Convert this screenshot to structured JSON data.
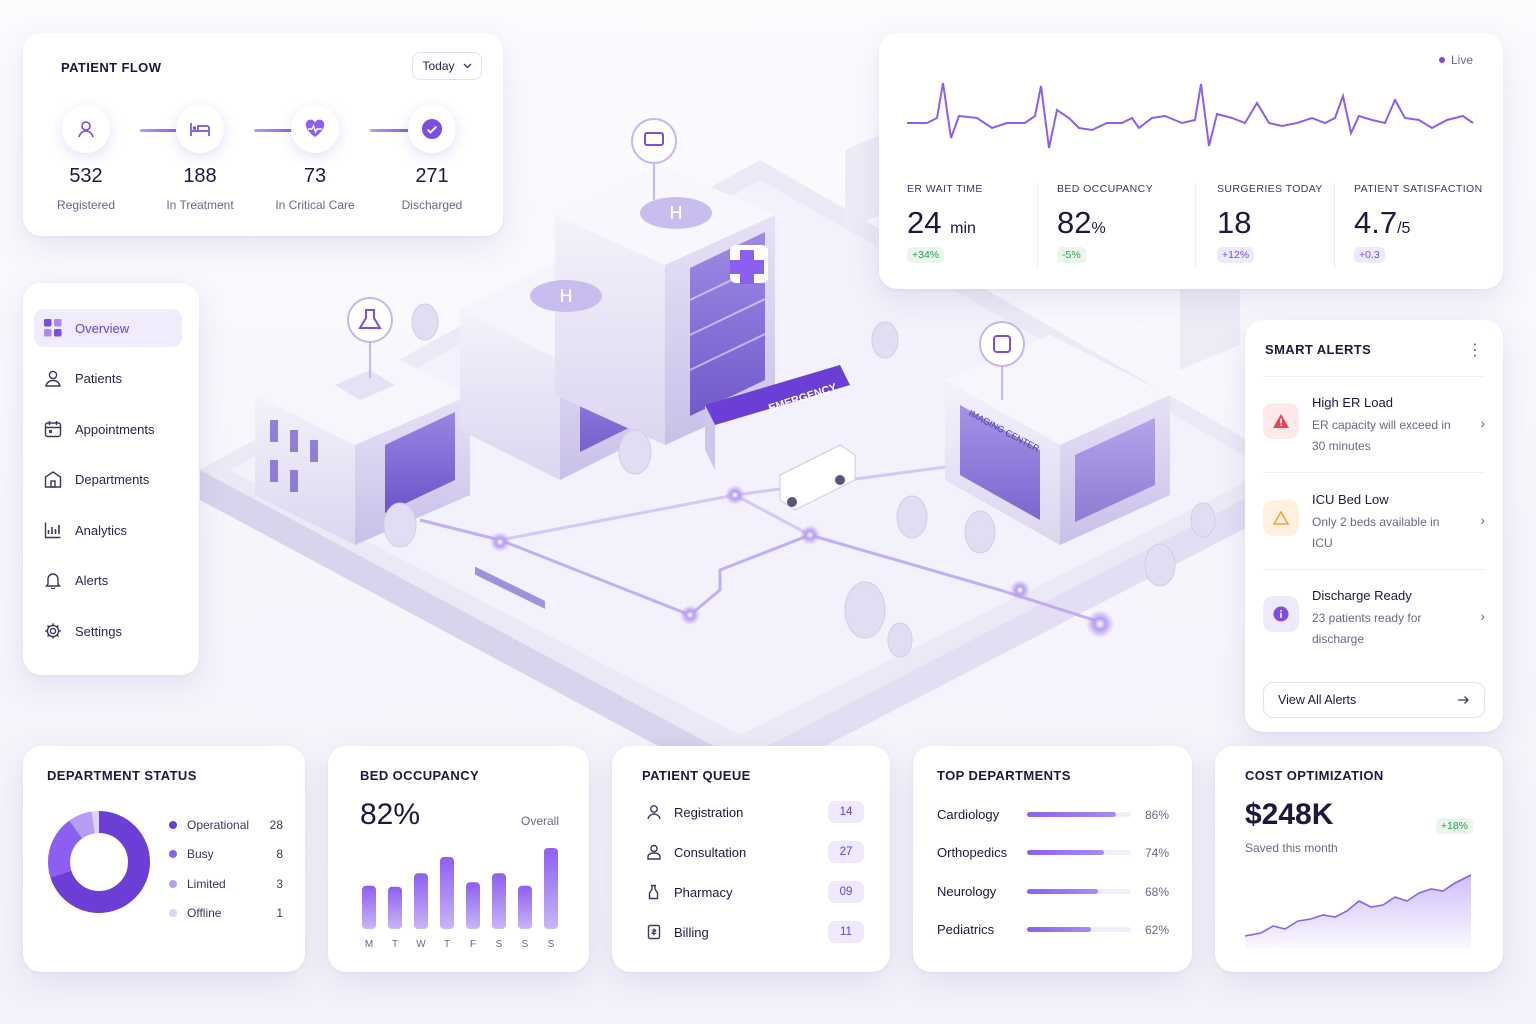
{
  "patient_flow": {
    "title": "PATIENT FLOW",
    "period": "Today",
    "steps": [
      {
        "value": "532",
        "label": "Registered",
        "icon": "user-icon"
      },
      {
        "value": "188",
        "label": "In Treatment",
        "icon": "bed-icon"
      },
      {
        "value": "73",
        "label": "In Critical Care",
        "icon": "heart-pulse-icon"
      },
      {
        "value": "271",
        "label": "Discharged",
        "icon": "check-icon"
      }
    ]
  },
  "vitals": {
    "live_label": "Live",
    "metrics": [
      {
        "label": "ER WAIT TIME",
        "value": "24",
        "unit": "min",
        "delta": "+34%"
      },
      {
        "label": "BED OCCUPANCY",
        "value": "82",
        "unit": "%",
        "delta": "-5%"
      },
      {
        "label": "SURGERIES TODAY",
        "value": "18",
        "unit": "",
        "delta": "+12%"
      },
      {
        "label": "PATIENT SATISFACTION",
        "value": "4.7",
        "unit": "/5",
        "delta": "+0.3"
      }
    ]
  },
  "sidebar": {
    "items": [
      {
        "label": "Overview",
        "icon": "grid-icon"
      },
      {
        "label": "Patients",
        "icon": "user-icon"
      },
      {
        "label": "Appointments",
        "icon": "calendar-icon"
      },
      {
        "label": "Departments",
        "icon": "building-icon"
      },
      {
        "label": "Analytics",
        "icon": "chart-icon"
      },
      {
        "label": "Alerts",
        "icon": "bell-icon"
      },
      {
        "label": "Settings",
        "icon": "gear-icon"
      }
    ]
  },
  "map": {
    "emergency_sign": "EMERGENCY",
    "imaging_sign": "IMAGING CENTER"
  },
  "alerts": {
    "title": "SMART ALERTS",
    "items": [
      {
        "title": "High ER Load",
        "desc": "ER capacity will exceed in 30 minutes",
        "icon": "warning-triangle-icon",
        "color": "#e0475b"
      },
      {
        "title": "ICU Bed Low",
        "desc": "Only 2 beds available in ICU",
        "icon": "alert-triangle-icon",
        "color": "#f0a03c"
      },
      {
        "title": "Discharge Ready",
        "desc": "23 patients ready for discharge",
        "icon": "info-icon",
        "color": "#7c4ddf"
      }
    ],
    "view_all": "View All Alerts"
  },
  "department_status": {
    "title": "DEPARTMENT STATUS",
    "items": [
      {
        "label": "Operational",
        "value": "28",
        "color": "#6b3fd6"
      },
      {
        "label": "Busy",
        "value": "8",
        "color": "#8d5ff0"
      },
      {
        "label": "Limited",
        "value": "3",
        "color": "#b79cf4"
      },
      {
        "label": "Offline",
        "value": "1",
        "color": "#ddd0fb"
      }
    ]
  },
  "bed_occupancy": {
    "title": "BED OCCUPANCY",
    "value": "82%",
    "caption": "Overall"
  },
  "patient_queue": {
    "title": "PATIENT QUEUE",
    "items": [
      {
        "label": "Registration",
        "count": "14",
        "icon": "user-icon"
      },
      {
        "label": "Consultation",
        "count": "27",
        "icon": "doctor-icon"
      },
      {
        "label": "Pharmacy",
        "count": "09",
        "icon": "pill-bottle-icon"
      },
      {
        "label": "Billing",
        "count": "11",
        "icon": "receipt-icon"
      }
    ]
  },
  "top_departments": {
    "title": "TOP DEPARTMENTS",
    "items": [
      {
        "label": "Cardiology",
        "pct": "86%",
        "fill": 0.86
      },
      {
        "label": "Orthopedics",
        "pct": "74%",
        "fill": 0.74
      },
      {
        "label": "Neurology",
        "pct": "68%",
        "fill": 0.68
      },
      {
        "label": "Pediatrics",
        "pct": "62%",
        "fill": 0.62
      }
    ]
  },
  "cost": {
    "title": "COST OPTIMIZATION",
    "value": "$248K",
    "delta": "+18%",
    "caption": "Saved this month"
  },
  "chart_data": {
    "type": "bar",
    "categories": [
      "M",
      "T",
      "W",
      "T",
      "F",
      "S",
      "S",
      "S"
    ],
    "values": [
      48,
      47,
      62,
      80,
      52,
      62,
      48,
      90
    ],
    "title": "BED OCCUPANCY"
  }
}
